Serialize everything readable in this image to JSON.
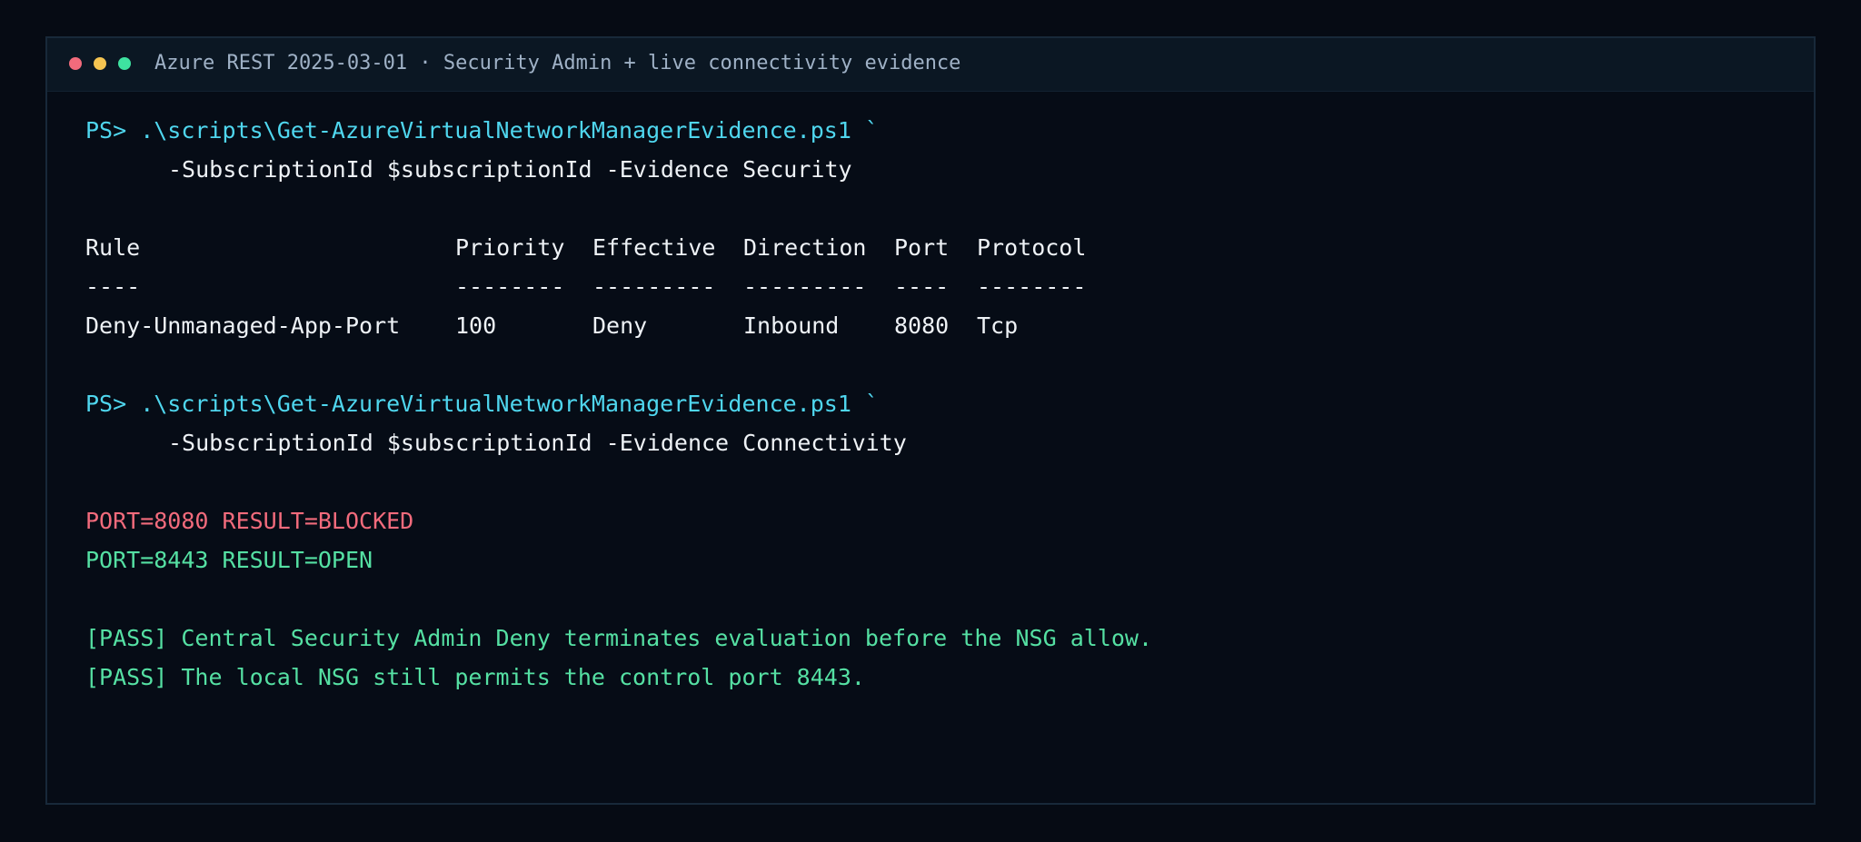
{
  "window": {
    "title": "Azure REST 2025-03-01 · Security Admin + live connectivity evidence",
    "buttons": {
      "close_color": "#f26b7c",
      "minimize_color": "#f5c451",
      "maximize_color": "#3ee2a0"
    }
  },
  "terminal": {
    "command1": {
      "line1": "PS> .\\scripts\\Get-AzureVirtualNetworkManagerEvidence.ps1 `",
      "line2": "-SubscriptionId $subscriptionId -Evidence Security"
    },
    "table": {
      "headers": [
        "Rule",
        "Priority",
        "Effective",
        "Direction",
        "Port",
        "Protocol"
      ],
      "separators": [
        "----",
        "--------",
        "---------",
        "---------",
        "----",
        "--------"
      ],
      "rows": [
        [
          "Deny-Unmanaged-App-Port",
          "100",
          "Deny",
          "Inbound",
          "8080",
          "Tcp"
        ]
      ]
    },
    "command2": {
      "line1": "PS> .\\scripts\\Get-AzureVirtualNetworkManagerEvidence.ps1 `",
      "line2": "-SubscriptionId $subscriptionId -Evidence Connectivity"
    },
    "results": [
      "PORT=8080 RESULT=BLOCKED",
      "PORT=8443 RESULT=OPEN"
    ],
    "checks": [
      "[PASS] Central Security Admin Deny terminates evaluation before the NSG allow.",
      "[PASS] The local NSG still permits the control port 8443."
    ]
  },
  "colors": {
    "background": "#060b14",
    "prompt": "#4fd6ee",
    "blocked": "#f26b7c",
    "open": "#55e0a3",
    "pass": "#55e0a3"
  }
}
